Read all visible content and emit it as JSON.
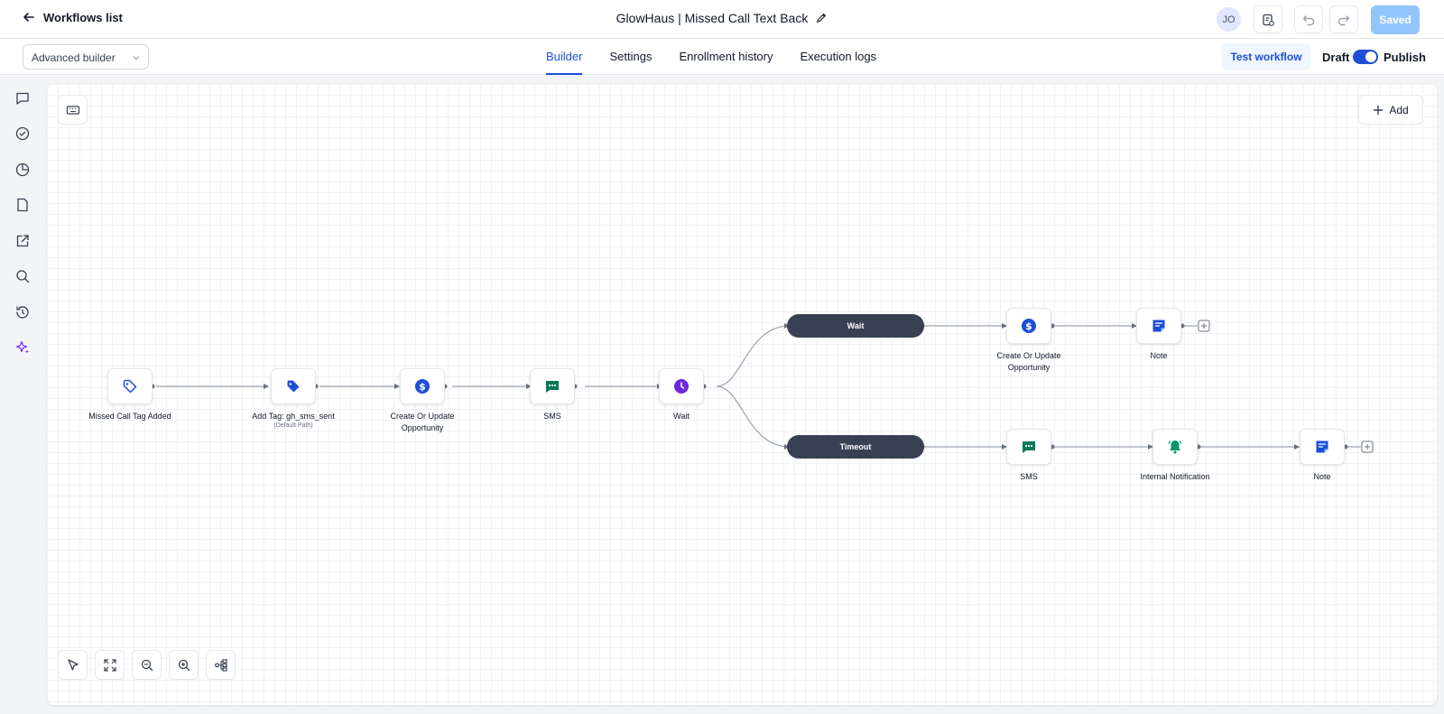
{
  "header": {
    "back_label": "Workflows list",
    "workflow_title": "GlowHaus | Missed Call Text Back",
    "avatar_initials": "JO",
    "saved_label": "Saved"
  },
  "subbar": {
    "builder_mode": "Advanced builder",
    "tabs": [
      "Builder",
      "Settings",
      "Enrollment history",
      "Execution logs"
    ],
    "active_tab": "Builder",
    "test_label": "Test workflow",
    "draft_label": "Draft",
    "publish_label": "Publish",
    "publish_enabled": true
  },
  "sidebar": {
    "icons": [
      "chat-icon",
      "check-circle-icon",
      "pie-chart-icon",
      "document-icon",
      "external-link-icon",
      "search-icon",
      "history-icon",
      "sparkle-icon"
    ]
  },
  "canvas": {
    "add_label": "Add",
    "nodes": [
      {
        "label": "Missed Call Tag Added",
        "icon": "tag-outline-icon"
      },
      {
        "label": "Add Tag: gh_sms_sent",
        "sublabel": "(Default Path)",
        "icon": "tag-filled-icon"
      },
      {
        "label": "Create Or Update Opportunity",
        "icon": "dollar-icon"
      },
      {
        "label": "SMS",
        "icon": "sms-icon"
      },
      {
        "label": "Wait",
        "icon": "clock-icon"
      },
      {
        "label": "Create Or Update Opportunity",
        "icon": "dollar-icon"
      },
      {
        "label": "Note",
        "icon": "note-icon"
      },
      {
        "label": "SMS",
        "icon": "sms-icon"
      },
      {
        "label": "Internal Notification",
        "icon": "bell-icon"
      },
      {
        "label": "Note",
        "icon": "note-icon"
      }
    ],
    "branches": [
      "Wait",
      "Timeout"
    ]
  },
  "colors": {
    "accent": "#1d4ed8",
    "saved_bg": "#93c5fd",
    "pill_bg": "#374151",
    "sms_green": "#047857",
    "wait_purple": "#6d28d9",
    "bell_green": "#059669"
  },
  "zoom_controls": [
    "pointer-icon",
    "fit-view-icon",
    "zoom-out-icon",
    "zoom-in-icon",
    "auto-layout-icon"
  ]
}
